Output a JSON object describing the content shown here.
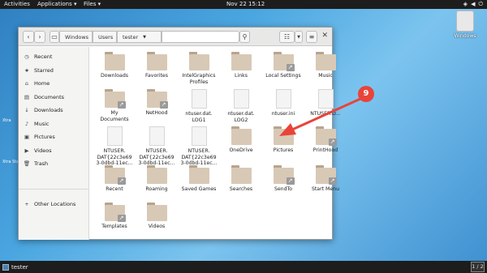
{
  "topbar": {
    "activities": "Activities",
    "applications": "Applications ▾",
    "files": "Files ▾",
    "clock": "Nov 22  15:12"
  },
  "desktop": {
    "icon_label": "Windows",
    "left_text_1": "Xtra",
    "left_text_2": "Xtra Start"
  },
  "window": {
    "path": [
      "Windows",
      "Users",
      "tester"
    ],
    "close": "✕"
  },
  "sidebar": {
    "items": [
      {
        "label": "Recent",
        "icon": "clock-icon"
      },
      {
        "label": "Starred",
        "icon": "star-icon"
      },
      {
        "label": "Home",
        "icon": "home-icon"
      },
      {
        "label": "Documents",
        "icon": "document-icon"
      },
      {
        "label": "Downloads",
        "icon": "download-icon"
      },
      {
        "label": "Music",
        "icon": "music-icon"
      },
      {
        "label": "Pictures",
        "icon": "picture-icon"
      },
      {
        "label": "Videos",
        "icon": "video-icon"
      },
      {
        "label": "Trash",
        "icon": "trash-icon"
      },
      {
        "label": "Other Locations",
        "icon": "plus-icon"
      }
    ]
  },
  "files": [
    {
      "label": "Downloads",
      "kind": "folder"
    },
    {
      "label": "Favorites",
      "kind": "folder"
    },
    {
      "label": "IntelGraphics\nProfiles",
      "kind": "folder"
    },
    {
      "label": "Links",
      "kind": "folder"
    },
    {
      "label": "Local Settings",
      "kind": "folder-link"
    },
    {
      "label": "Music",
      "kind": "folder"
    },
    {
      "label": "My\nDocuments",
      "kind": "folder-link"
    },
    {
      "label": "NetHood",
      "kind": "folder-link"
    },
    {
      "label": "ntuser.dat.\nLOG1",
      "kind": "file"
    },
    {
      "label": "ntuser.dat.\nLOG2",
      "kind": "file"
    },
    {
      "label": "ntuser.ini",
      "kind": "file"
    },
    {
      "label": "NTUSER.D...",
      "kind": "file"
    },
    {
      "label": "NTUSER.\nDAT{22c3e69\n3-0dbd-11ec...",
      "kind": "file"
    },
    {
      "label": "NTUSER.\nDAT{22c3e69\n3-0dbd-11ec...",
      "kind": "file"
    },
    {
      "label": "NTUSER.\nDAT{22c3e69\n3-0dbd-11ec...",
      "kind": "file"
    },
    {
      "label": "OneDrive",
      "kind": "folder"
    },
    {
      "label": "Pictures",
      "kind": "folder"
    },
    {
      "label": "PrintHood",
      "kind": "folder-link"
    },
    {
      "label": "Recent",
      "kind": "folder-link"
    },
    {
      "label": "Roaming",
      "kind": "folder"
    },
    {
      "label": "Saved Games",
      "kind": "folder"
    },
    {
      "label": "Searches",
      "kind": "folder"
    },
    {
      "label": "SendTo",
      "kind": "folder-link"
    },
    {
      "label": "Start Menu",
      "kind": "folder-link"
    },
    {
      "label": "Templates",
      "kind": "folder-link"
    },
    {
      "label": "Videos",
      "kind": "folder"
    }
  ],
  "annotation": {
    "step": "9",
    "color": "#e8443a"
  },
  "taskbar": {
    "task": "tester",
    "pager": "1 / 2"
  }
}
